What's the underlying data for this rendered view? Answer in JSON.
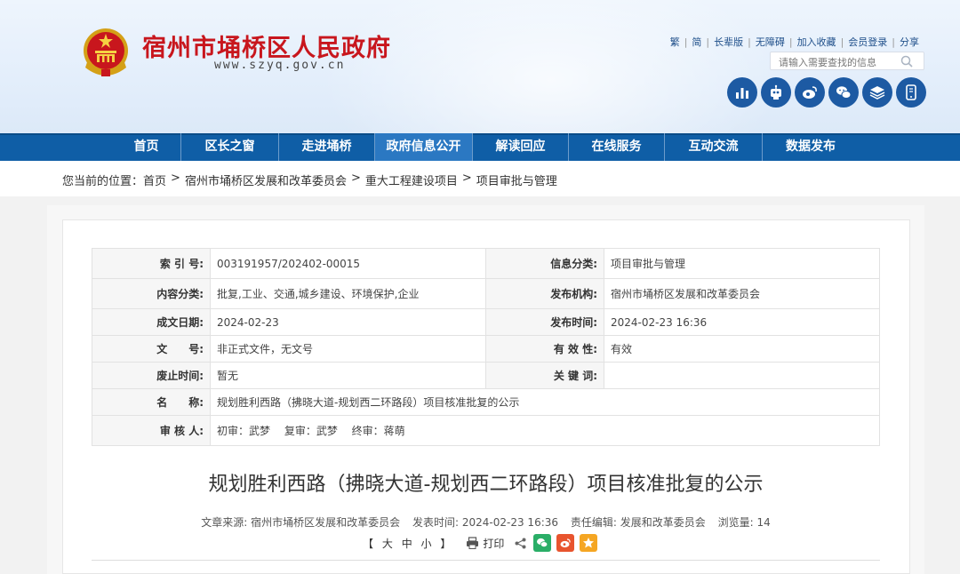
{
  "header": {
    "title": "宿州市埇桥区人民政府",
    "url": "www.szyq.gov.cn",
    "top_links": [
      "繁",
      "简",
      "长辈版",
      "无障碍",
      "加入收藏",
      "会员登录",
      "分享"
    ],
    "search_placeholder": "请输入需要查找的信息",
    "quick_icons": [
      "bar-chart-icon",
      "robot-icon",
      "weibo-icon",
      "wechat-icon",
      "layers-icon",
      "mobile-icon"
    ]
  },
  "nav": {
    "items": [
      "首页",
      "区长之窗",
      "走进埇桥",
      "政府信息公开",
      "解读回应",
      "在线服务",
      "互动交流",
      "数据发布"
    ],
    "active_index": 3
  },
  "breadcrumb": {
    "prefix": "您当前的位置：",
    "items": [
      "首页",
      "宿州市埇桥区发展和改革委员会",
      "重大工程建设项目",
      "项目审批与管理"
    ],
    "separator": ">"
  },
  "meta": {
    "index_label": "索 引 号:",
    "index_value": "003191957/202402-00015",
    "category_label": "信息分类:",
    "category_value": "项目审批与管理",
    "content_type_label": "内容分类:",
    "content_type_value": "批复,工业、交通,城乡建设、环境保护,企业",
    "publisher_label": "发布机构:",
    "publisher_value": "宿州市埇桥区发展和改革委员会",
    "created_label": "成文日期:",
    "created_value": "2024-02-23",
    "published_label": "发布时间:",
    "published_value": "2024-02-23 16:36",
    "docno_label": "文　　号:",
    "docno_value": "非正式文件，无文号",
    "validity_label": "有 效 性:",
    "validity_value": "有效",
    "abolish_label": "废止时间:",
    "abolish_value": "暂无",
    "keywords_label": "关 键 词:",
    "keywords_value": "",
    "name_label": "名　　称:",
    "name_value": "规划胜利西路（拂晓大道-规划西二环路段）项目核准批复的公示",
    "reviewer_label": "审 核 人:",
    "reviewer_value": "初审：武梦　  复审：武梦　  终审：蒋萌"
  },
  "article": {
    "title": "规划胜利西路（拂晓大道-规划西二环路段）项目核准批复的公示",
    "source_label": "文章来源:",
    "source_value": "宿州市埇桥区发展和改革委员会",
    "date_label": "发表时间:",
    "date_value": "2024-02-23 16:36",
    "editor_label": "责任编辑:",
    "editor_value": "发展和改革委员会",
    "views_label": "浏览量:",
    "views_value": "14",
    "font_open": "【",
    "font_large": "大",
    "font_medium": "中",
    "font_small": "小",
    "font_close": "】",
    "print_label": "打印",
    "share_colors": {
      "wechat": "#2aae67",
      "weibo": "#e8542e",
      "favorite": "#f5a623"
    }
  }
}
